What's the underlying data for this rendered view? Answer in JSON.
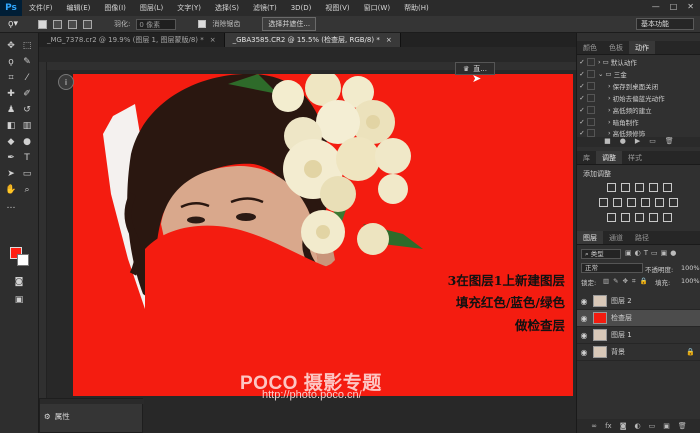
{
  "app": {
    "logo": "Ps",
    "menu": [
      "文件(F)",
      "编辑(E)",
      "图像(I)",
      "图层(L)",
      "文字(Y)",
      "选择(S)",
      "滤镜(T)",
      "3D(D)",
      "视图(V)",
      "窗口(W)",
      "帮助(H)"
    ],
    "window_controls": [
      "—",
      "□",
      "✕"
    ]
  },
  "options_bar": {
    "feather_label": "羽化:",
    "feather_value": "0 像素",
    "antialias_label": "消除锯齿",
    "select_mask_button": "选择并遮住...",
    "workspace": "基本功能"
  },
  "tabs": [
    {
      "label": "_MG_7378.cr2 @ 19.9% (图层 1, 图层蒙版/8) *",
      "close": "×"
    },
    {
      "label": "_GBA3585.CR2 @ 15.5% (检查层, RGB/8) *",
      "close": "×"
    }
  ],
  "canvas": {
    "background": "#f41c10",
    "caption_lines": [
      "3在图层1上新建图层",
      "填充红色/蓝色/绿色",
      "做检查层"
    ],
    "watermark_brand": "POCO 摄影专题",
    "watermark_url": "http://photo.poco.cn/",
    "floating_hint": "直..."
  },
  "properties_panel": {
    "label": "属性"
  },
  "right_dock": {
    "top_tabs": [
      "颜色",
      "色板",
      "动作"
    ],
    "actions": [
      {
        "label": "默认动作",
        "type": "set"
      },
      {
        "label": "三金",
        "type": "set"
      },
      {
        "label": "保存到桌面关闭",
        "type": "action"
      },
      {
        "label": "初始去偏蓝光动作",
        "type": "action"
      },
      {
        "label": "高低频的建立",
        "type": "action"
      },
      {
        "label": "暗角制作",
        "type": "action"
      },
      {
        "label": "高低频修饰",
        "type": "action"
      }
    ],
    "adjust_tabs": [
      "库",
      "调整",
      "样式"
    ],
    "adjust_title": "添加调整",
    "layers_tabs": [
      "图层",
      "通道",
      "路径"
    ],
    "layer_filter": "类型",
    "blend_mode": "正常",
    "opacity_label": "不透明度:",
    "opacity_value": "100%",
    "lock_label": "锁定:",
    "fill_label": "填充:",
    "fill_value": "100%",
    "layers": [
      {
        "name": "图层 2",
        "selected": false
      },
      {
        "name": "检查层",
        "selected": true
      },
      {
        "name": "图层 1",
        "selected": false
      },
      {
        "name": "背景",
        "selected": false
      }
    ],
    "accent": "#f41c10"
  }
}
